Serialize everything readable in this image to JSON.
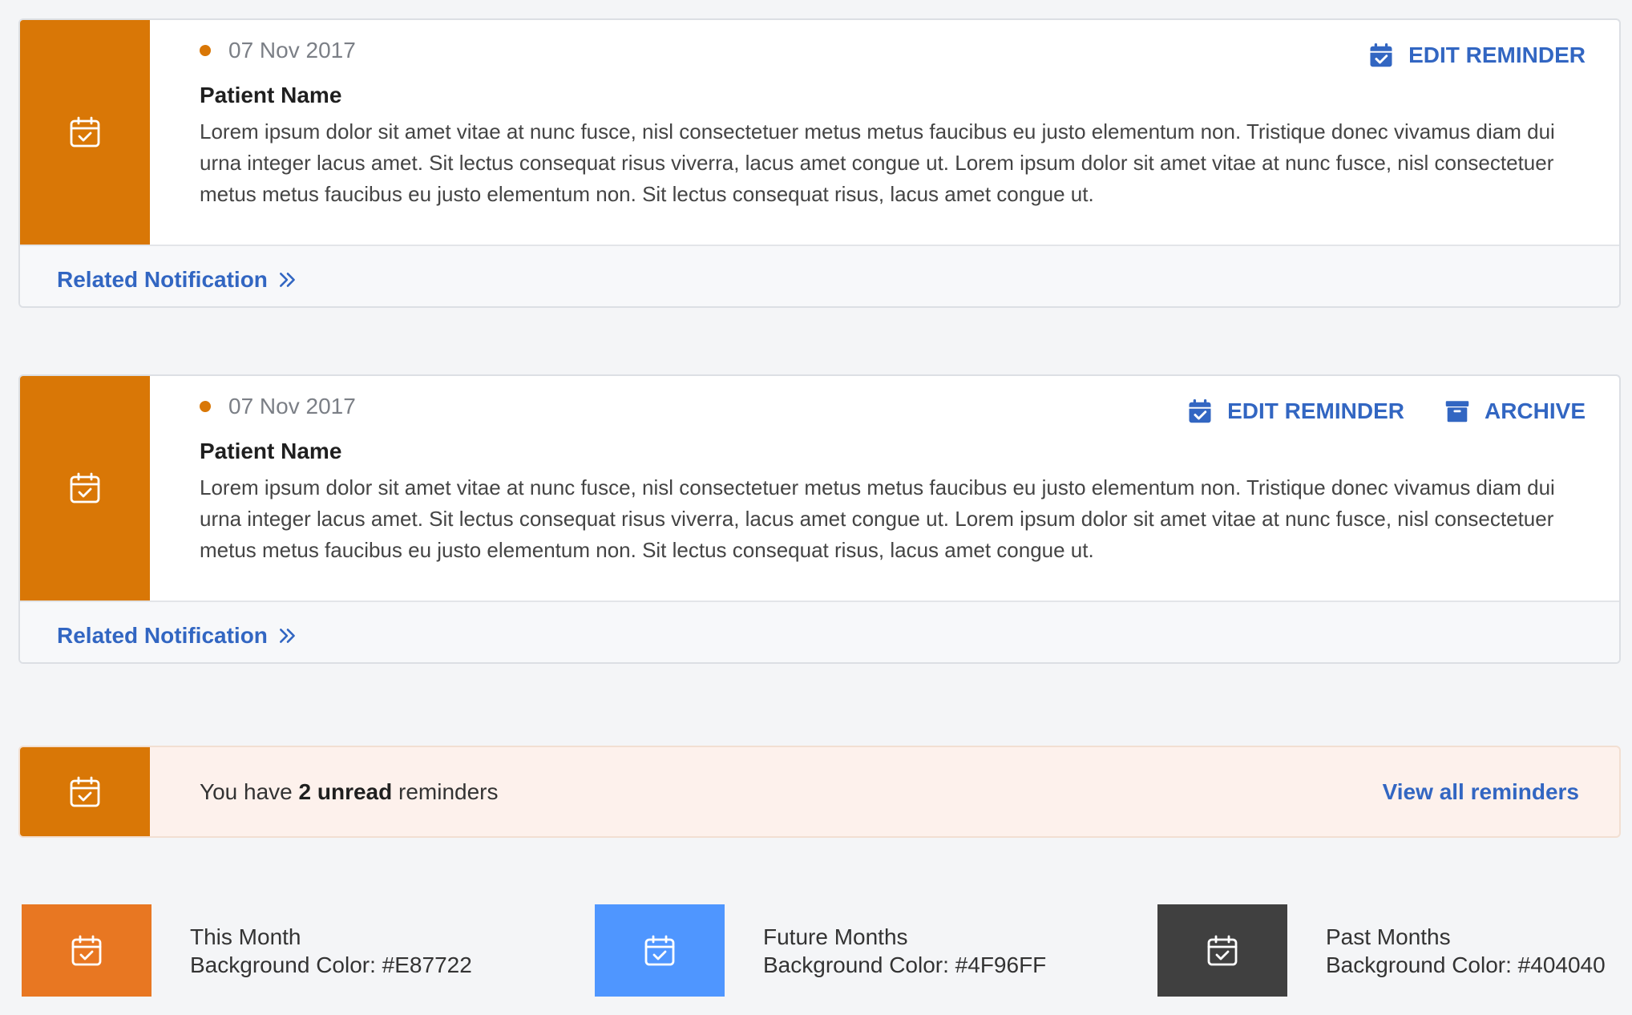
{
  "colors": {
    "this_month": "#E87722",
    "future_months": "#4F96FF",
    "past_months": "#404040",
    "accent_side": "#D97706",
    "link": "#3266C2",
    "dot": "#D97706"
  },
  "icons": {
    "side": "calendar-check-icon",
    "edit": "calendar-edit-icon",
    "archive": "archive-icon",
    "chevron": "double-chevron-right-icon"
  },
  "cards": [
    {
      "date": "07 Nov 2017",
      "patient_name": "Patient Name",
      "description": "Lorem ipsum dolor sit amet vitae at nunc fusce, nisl consectetuer metus metus faucibus eu justo elementum non. Tristique donec vivamus diam dui urna integer lacus amet. Sit lectus consequat risus viverra, lacus amet congue ut.  Lorem ipsum dolor sit amet vitae at nunc fusce, nisl consectetuer metus metus faucibus eu justo elementum non. Sit lectus consequat risus, lacus amet congue ut.",
      "edit_label": "EDIT REMINDER",
      "related_label": "Related Notification"
    },
    {
      "date": "07 Nov 2017",
      "patient_name": "Patient Name",
      "description": "Lorem ipsum dolor sit amet vitae at nunc fusce, nisl consectetuer metus metus faucibus eu justo elementum non. Tristique donec vivamus diam dui urna integer lacus amet. Sit lectus consequat risus viverra, lacus amet congue ut.  Lorem ipsum dolor sit amet vitae at nunc fusce, nisl consectetuer metus metus faucibus eu justo elementum non. Sit lectus consequat risus, lacus amet congue ut.",
      "edit_label": "EDIT REMINDER",
      "archive_label": "ARCHIVE",
      "related_label": "Related Notification"
    }
  ],
  "banner": {
    "text_prefix": "You have ",
    "text_bold": "2 unread",
    "text_suffix": " reminders",
    "link_label": "View all reminders"
  },
  "legend": [
    {
      "title": "This Month",
      "subtitle": "Background Color: #E87722"
    },
    {
      "title": "Future Months",
      "subtitle": "Background Color: #4F96FF"
    },
    {
      "title": "Past Months",
      "subtitle": "Background Color: #404040"
    }
  ]
}
